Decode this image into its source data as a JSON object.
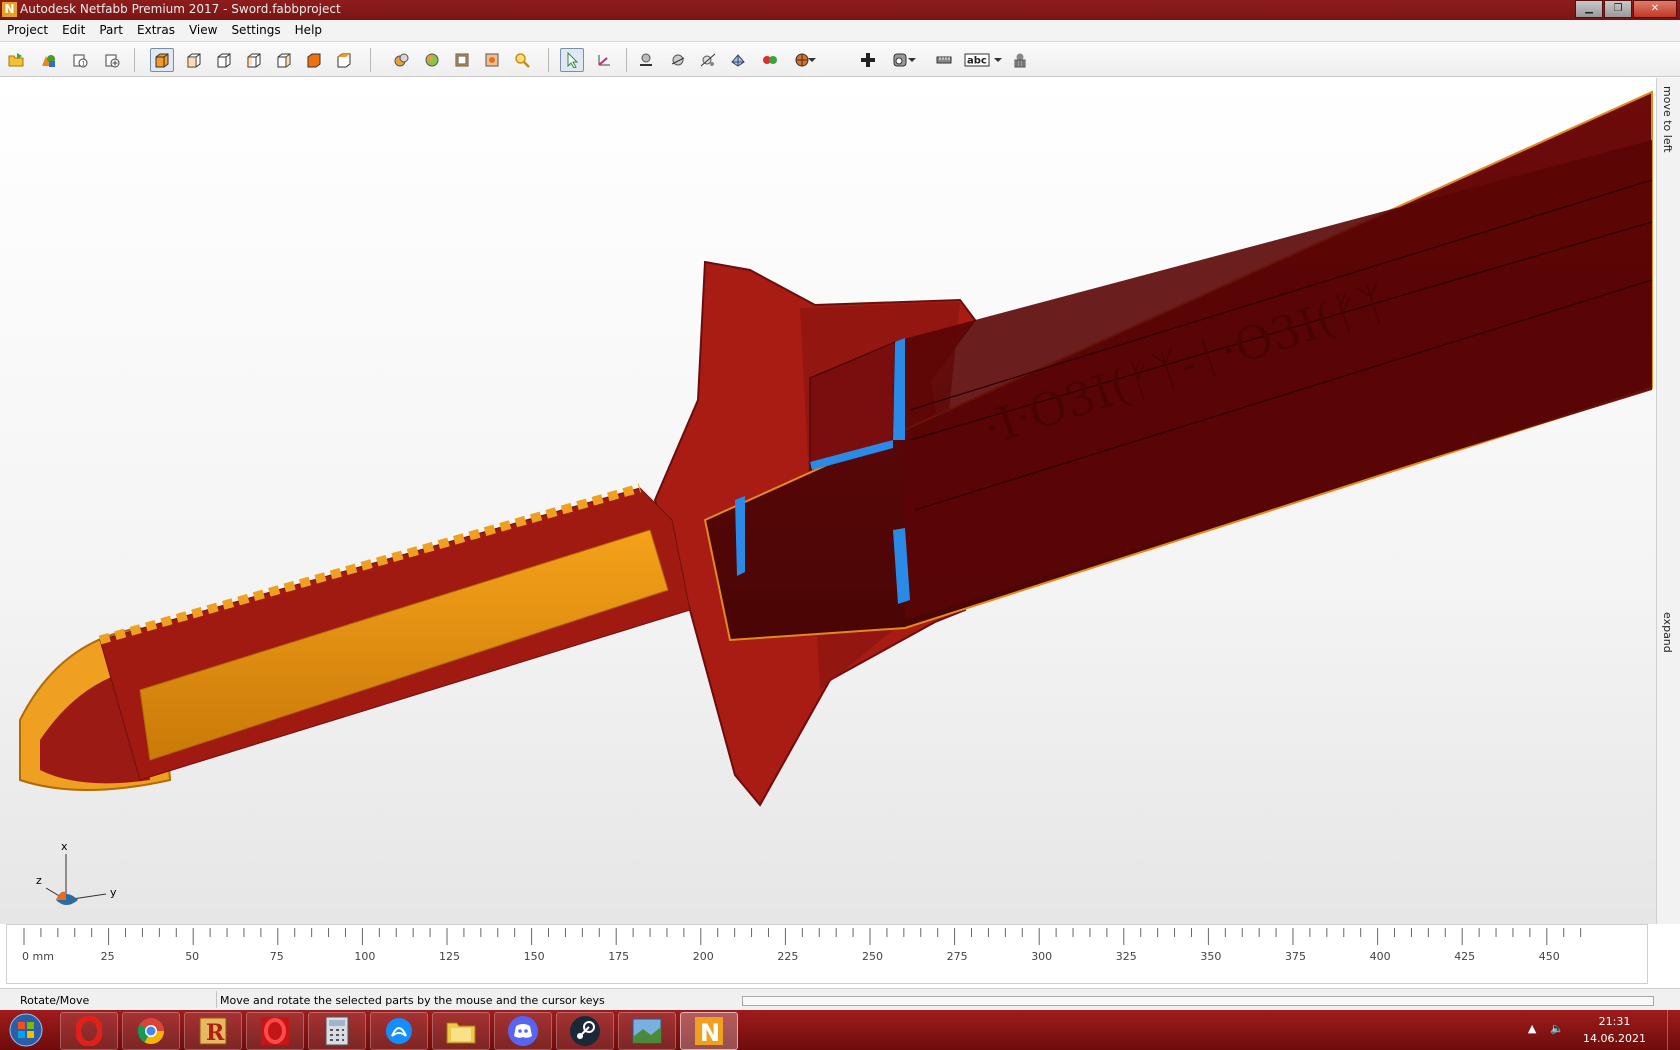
{
  "window": {
    "app_icon_letter": "N",
    "title": "Autodesk Netfabb Premium 2017 - Sword.fabbproject",
    "buttons": [
      "minimize-button",
      "maximize-button",
      "close-button"
    ]
  },
  "menu": [
    "Project",
    "Edit",
    "Part",
    "Extras",
    "View",
    "Settings",
    "Help"
  ],
  "toolbar": {
    "groups": [
      [
        "open-project-icon",
        "add-part-icon",
        "part-info-icon",
        "add-repair-icon"
      ],
      [
        "view-solid-icon",
        "view-front-icon",
        "view-back-icon",
        "view-left-icon",
        "view-right-icon",
        "view-top-icon",
        "view-bottom-icon"
      ],
      [
        "zoom-parts-icon",
        "zoom-all-icon",
        "zoom-selected-icon",
        "zoom-window-icon",
        "magnifier-icon"
      ],
      [
        "select-cursor-icon",
        "move-axis-icon"
      ],
      [
        "cut-plane-icon",
        "section-icon",
        "measure-points-icon",
        "mesh-icon",
        "color-spheres-icon",
        "render-sphere-icon",
        "add-cross-icon",
        "lasso-icon",
        "ruler-icon",
        "abc-label-icon",
        "bin-icon"
      ]
    ]
  },
  "viewport": {
    "axes": {
      "x": "x",
      "y": "y",
      "z": "z"
    }
  },
  "side_panel": {
    "top_label": "move to left",
    "bottom_label": "expand"
  },
  "ruler": {
    "labels": [
      "0 mm",
      "25",
      "50",
      "75",
      "100",
      "125",
      "150",
      "175",
      "200",
      "225",
      "250",
      "275",
      "300",
      "325",
      "350",
      "375",
      "400",
      "425",
      "450"
    ]
  },
  "status": {
    "mode": "Rotate/Move",
    "message": "Move and rotate the selected parts by the mouse and the cursor keys"
  },
  "taskbar": {
    "apps": [
      "windows-start-icon",
      "opera-icon",
      "chrome-icon",
      "r-app-icon",
      "opera-gx-icon",
      "calculator-icon",
      "battle-net-icon",
      "file-explorer-icon",
      "discord-icon",
      "steam-icon",
      "photo-viewer-icon",
      "netfabb-icon"
    ],
    "time": "21:31",
    "date": "14.06.2021"
  }
}
